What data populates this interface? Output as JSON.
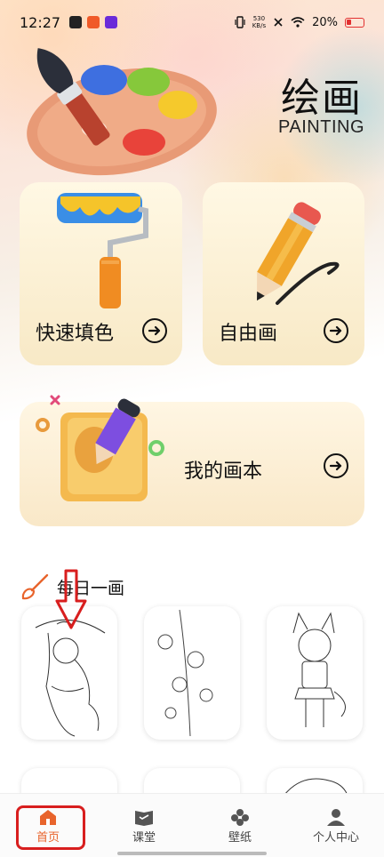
{
  "status_bar": {
    "time": "12:27",
    "net_speed_value": "530",
    "net_speed_unit": "KB/s",
    "battery": "20%"
  },
  "header": {
    "title": "绘画",
    "subtitle": "PAINTING"
  },
  "cards": {
    "quick_fill": {
      "label": "快速填色"
    },
    "free_draw": {
      "label": "自由画"
    },
    "my_book": {
      "label": "我的画本"
    }
  },
  "daily": {
    "title": "每日一画"
  },
  "bottom_nav": {
    "items": [
      {
        "label": "首页",
        "icon": "home-icon",
        "active": true
      },
      {
        "label": "课堂",
        "icon": "classroom-icon",
        "active": false
      },
      {
        "label": "壁纸",
        "icon": "wallpaper-icon",
        "active": false
      },
      {
        "label": "个人中心",
        "icon": "profile-icon",
        "active": false
      }
    ]
  },
  "colors": {
    "accent": "#e8642c",
    "annotation": "#d81e1e"
  }
}
